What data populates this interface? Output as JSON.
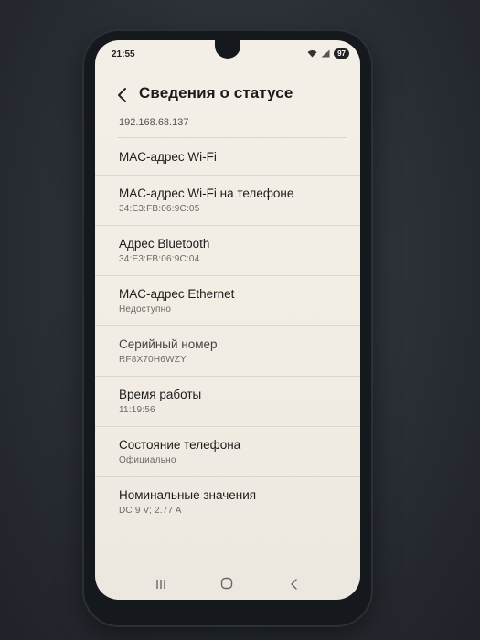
{
  "status_bar": {
    "time": "21:55",
    "battery": "97"
  },
  "header": {
    "title": "Сведения о статусе"
  },
  "ip_value": "192.168.68.137",
  "items": [
    {
      "title": "MAC-адрес Wi-Fi",
      "value": ""
    },
    {
      "title": "MAC-адрес Wi-Fi на телефоне",
      "value": "34:E3:FB:06:9C:05"
    },
    {
      "title": "Адрес Bluetooth",
      "value": "34:E3:FB:06:9C:04"
    },
    {
      "title": "MAC-адрес Ethernet",
      "value": "Недоступно"
    },
    {
      "title": "Серийный номер",
      "value": "RF8X70H6WZY"
    },
    {
      "title": "Время работы",
      "value": "11:19:56"
    },
    {
      "title": "Состояние телефона",
      "value": "Официально"
    },
    {
      "title": "Номинальные значения",
      "value": "DC 9 V; 2.77 A"
    }
  ],
  "nav": {
    "icons": [
      "recent-apps-icon",
      "home-icon",
      "back-icon"
    ]
  }
}
